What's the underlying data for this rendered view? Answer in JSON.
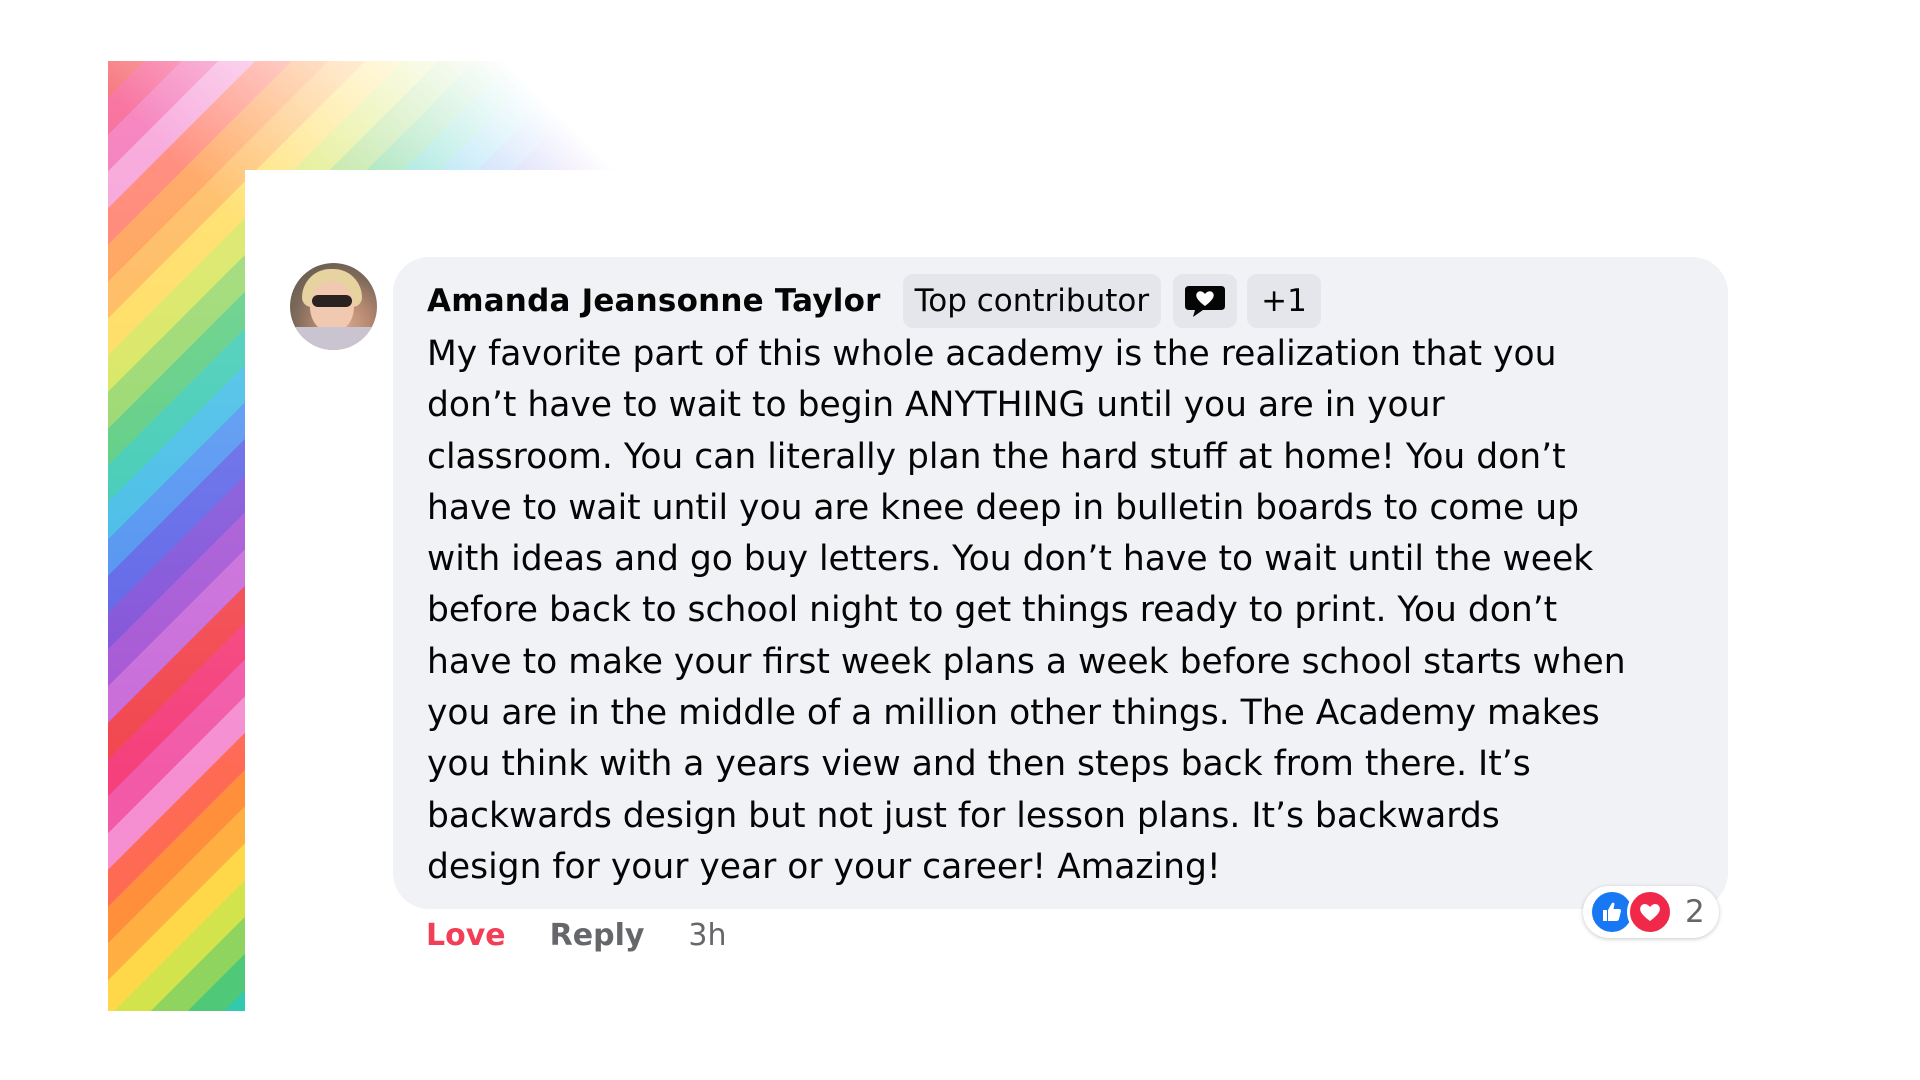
{
  "comment": {
    "author": "Amanda Jeansonne Taylor",
    "badge": "Top contributor",
    "badge_icon": "speech-bubble-heart-icon",
    "extra_badges": "+1",
    "text": "My favorite part of this whole academy is the realization that you\ndon’t have to wait to begin ANYTHING until you are in your\nclassroom. You can literally plan the hard stuff at home! You don’t\nhave to wait until you are knee deep in bulletin boards to come up\nwith ideas and go buy letters. You don’t have to wait until the week\nbefore back to school night to get things ready to print. You don’t\nhave to make your first week plans a week before school starts when\nyou are in the middle of a million other things. The Academy makes\nyou think with a years view and then steps back from there. It’s\nbackwards design but not just for lesson plans. It’s backwards\ndesign for your year or your career! Amazing!",
    "reactions": {
      "types": [
        "like-icon",
        "love-icon"
      ],
      "count": "2"
    },
    "actions": {
      "love": "Love",
      "reply": "Reply",
      "time": "3h"
    }
  },
  "colors": {
    "bubble": "#f0f2f5",
    "love_red": "#f33e58",
    "like_blue": "#1877f2",
    "secondary_text": "#65676b"
  }
}
